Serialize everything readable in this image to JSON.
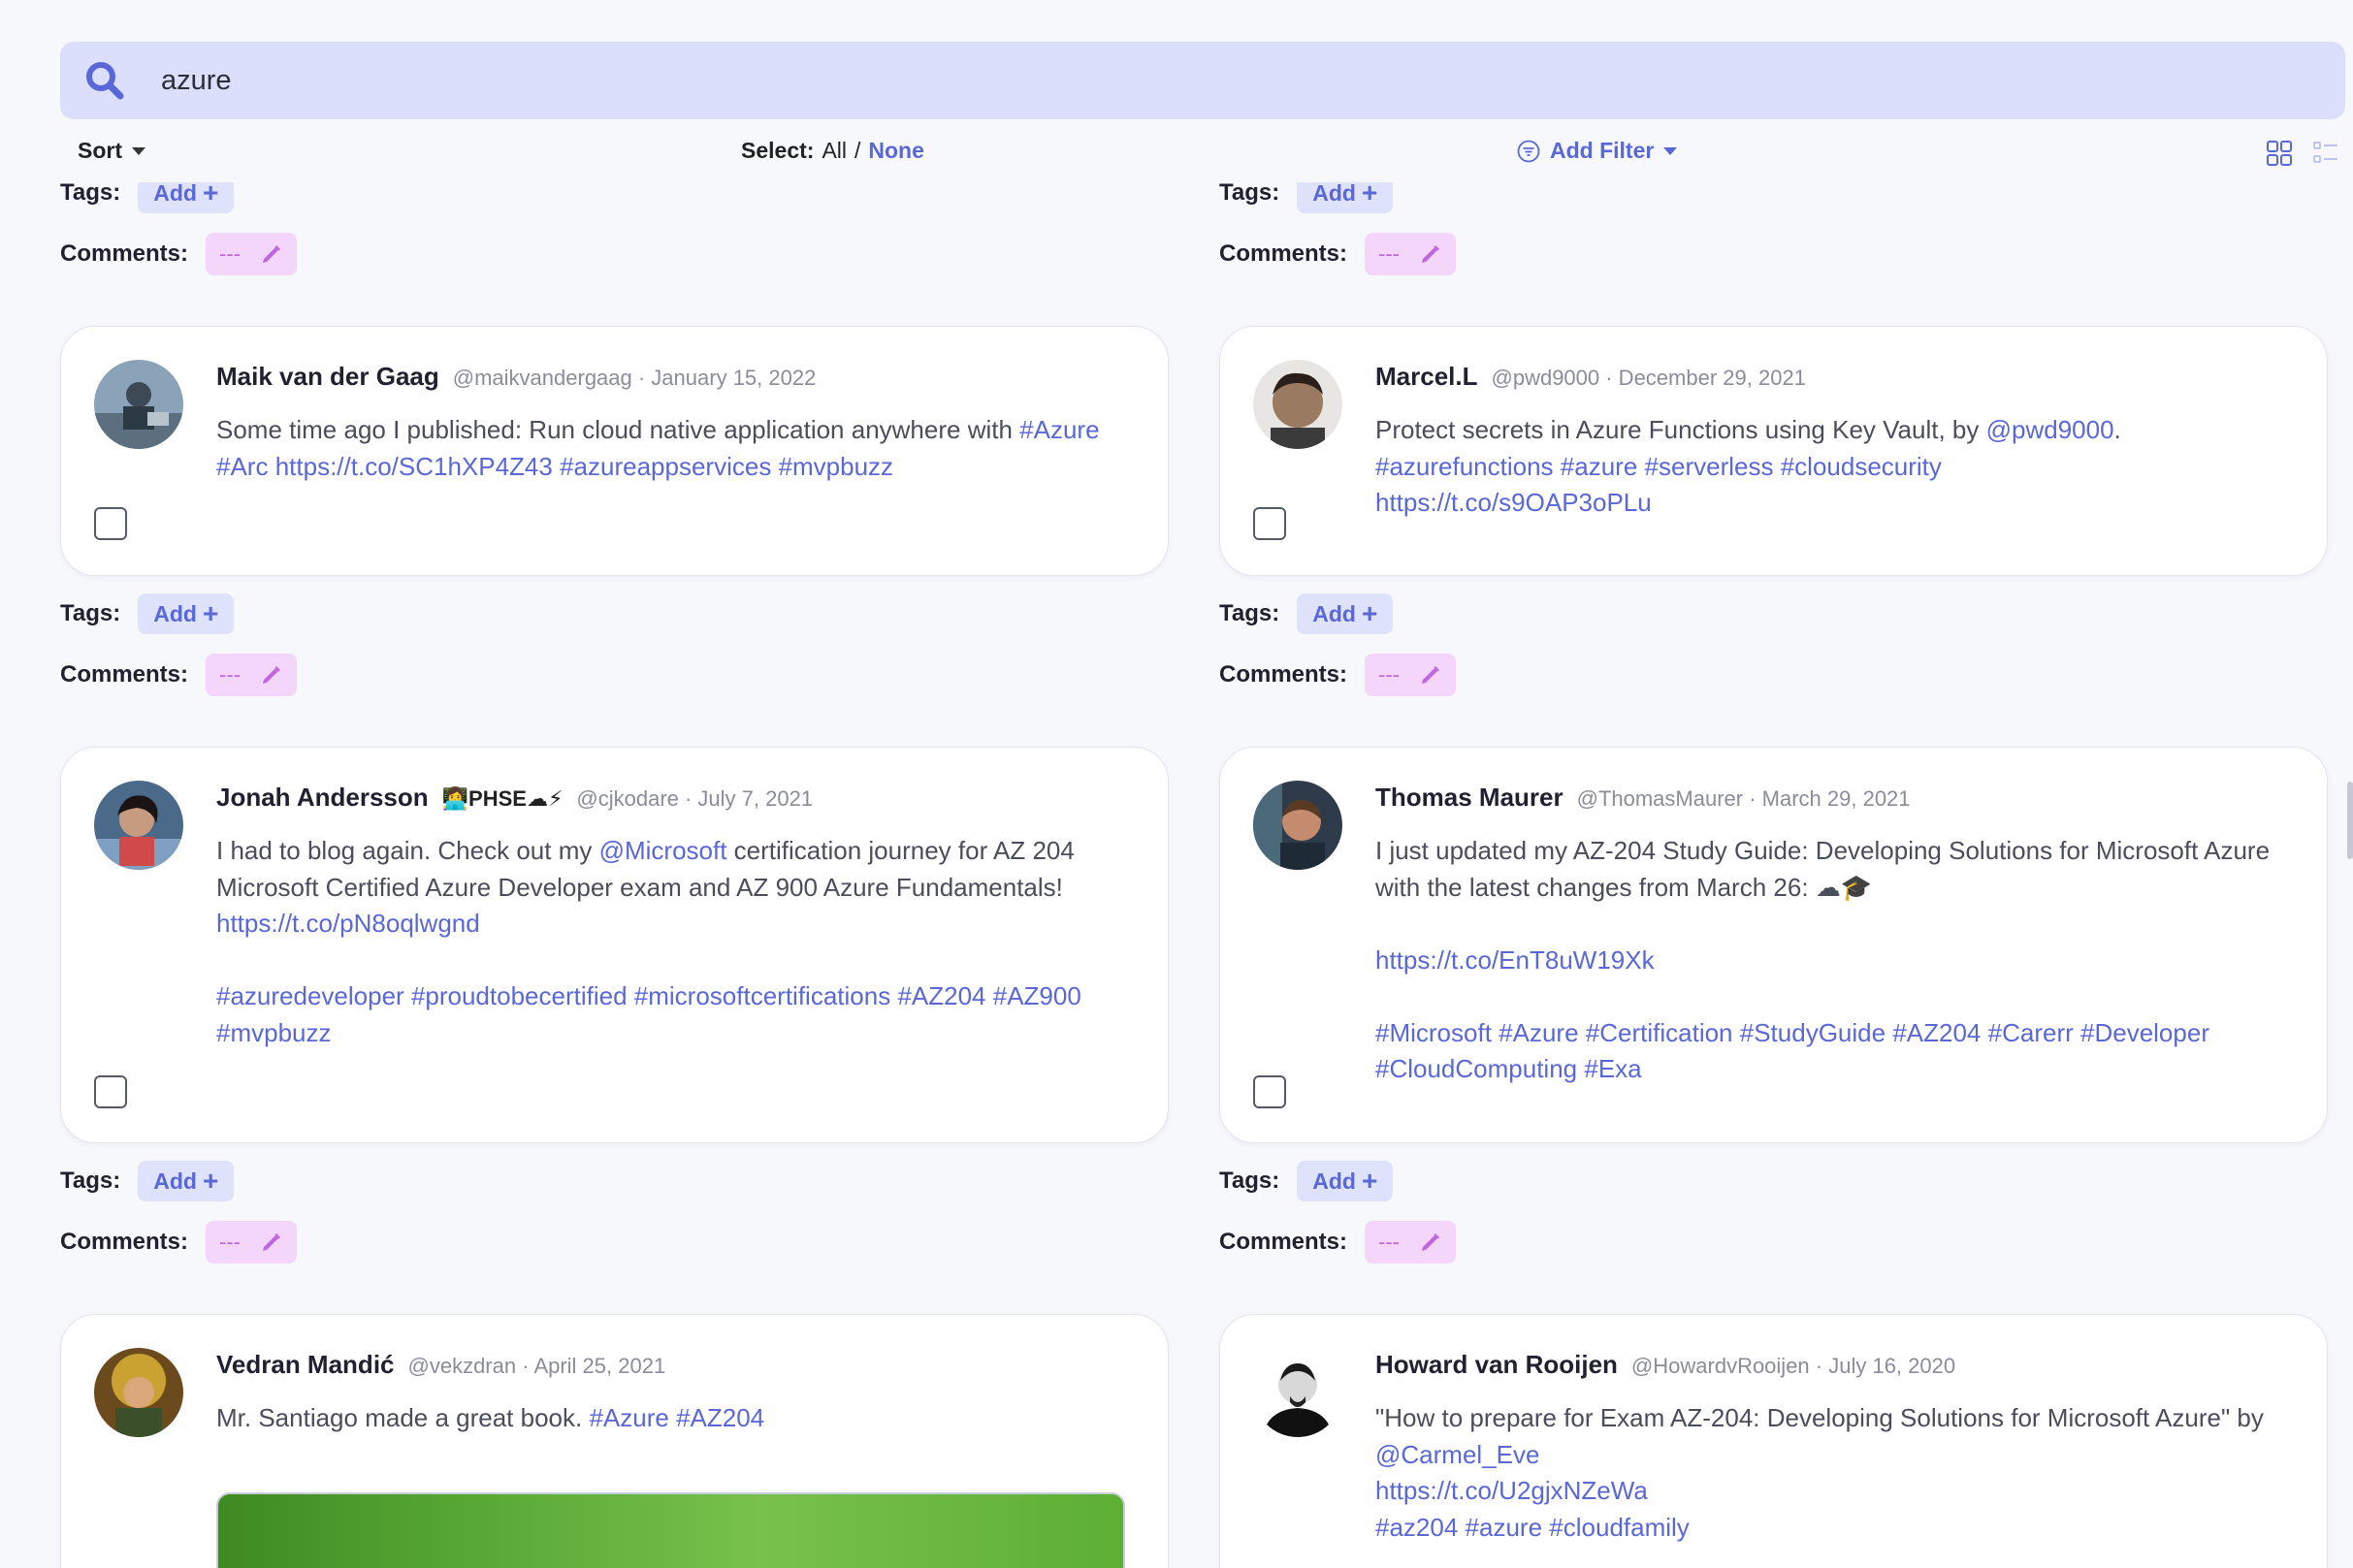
{
  "search": {
    "value": "azure",
    "placeholder": ""
  },
  "toolbar": {
    "sort_label": "Sort",
    "select_label": "Select:",
    "select_all": "All",
    "select_sep": "/",
    "select_none": "None",
    "add_filter": "Add Filter"
  },
  "meta": {
    "tags_label": "Tags:",
    "add_label": "Add",
    "comments_label": "Comments:",
    "comment_placeholder": "---"
  },
  "cards": [
    {
      "name": "Maik van der Gaag",
      "handle_date": "@maikvandergaag · January 15, 2022",
      "text_html": "Some time ago I published: Run cloud native application anywhere with <span class='hl'>#Azure</span> <span class='hl'>#Arc</span> <span class='hl'>https://t.co/SC1hXP4Z43</span> <span class='hl'>#azureappservices</span> <span class='hl'>#mvpbuzz</span>"
    },
    {
      "name": "Marcel.L",
      "handle_date": "@pwd9000 · December 29, 2021",
      "text_html": "Protect secrets in Azure Functions using Key Vault, by <span class='hl'>@pwd9000</span>.<br><span class='hl'>#azurefunctions</span> <span class='hl'>#azure</span> <span class='hl'>#serverless</span> <span class='hl'>#cloudsecurity</span><br><span class='hl'>https://t.co/s9OAP3oPLu</span>"
    },
    {
      "name": "Jonah Andersson",
      "badge": "👩‍💻PHSE☁⚡",
      "handle_date": "@cjkodare · July 7, 2021",
      "text_html": "I had to blog again. Check out my <span class='hl'>@Microsoft</span> certification journey for AZ 204 Microsoft Certified Azure Developer exam and AZ 900 Azure Fundamentals!<br><span class='hl'>https://t.co/pN8oqlwgnd</span><br><br><span class='hl'>#azuredeveloper</span> <span class='hl'>#proudtobecertified</span> <span class='hl'>#microsoftcertifications</span> <span class='hl'>#AZ204</span> <span class='hl'>#AZ900</span> <span class='hl'>#mvpbuzz</span>"
    },
    {
      "name": "Thomas Maurer",
      "handle_date": "@ThomasMaurer · March 29, 2021",
      "text_html": "I just updated my AZ-204 Study Guide: Developing Solutions for Microsoft Azure with the latest changes from March 26: ☁🎓<br><br><span class='hl'>https://t.co/EnT8uW19Xk</span><br><br><span class='hl'>#Microsoft</span> <span class='hl'>#Azure</span> <span class='hl'>#Certification</span> <span class='hl'>#StudyGuide</span> <span class='hl'>#AZ204</span> <span class='hl'>#Carerr</span> <span class='hl'>#Developer</span> <span class='hl'>#CloudComputing</span> <span class='hl'>#Exa</span>"
    },
    {
      "name": "Vedran Mandić",
      "handle_date": "@vekzdran · April 25, 2021",
      "text_html": "Mr. Santiago made a great book. <span class='hl'>#Azure</span> <span class='hl'>#AZ204</span>"
    },
    {
      "name": "Howard van Rooijen",
      "handle_date": "@HowardvRooijen · July 16, 2020",
      "text_html": "\"How to prepare for Exam AZ-204: Developing Solutions for Microsoft Azure\" by <span class='hl'>@Carmel_Eve</span><br><span class='hl'>https://t.co/U2gjxNZeWa</span><br><span class='hl'>#az204</span> <span class='hl'>#azure</span> <span class='hl'>#cloudfamily</span>"
    }
  ],
  "colors": {
    "accent": "#5a67d8",
    "search_bg": "#dcdffb",
    "tag_bg": "#dfe2fb",
    "comment_bg": "#f5d6fb",
    "comment_fg": "#c067e0"
  }
}
